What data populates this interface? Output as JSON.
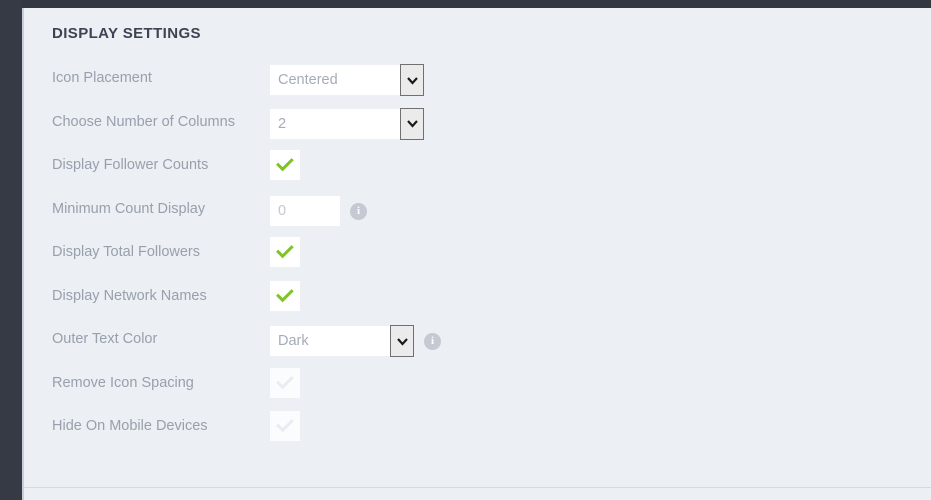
{
  "panel": {
    "title": "DISPLAY SETTINGS"
  },
  "colors": {
    "page_background": "#eceff3",
    "chrome_dark": "#353a45",
    "topbar_dark": "#333741",
    "label_text": "#98a0ad",
    "title_text": "#3d4352",
    "check_green": "#7dc424",
    "check_disabled": "#e9edf1",
    "info_icon": "#c4c9d2"
  },
  "settings": [
    {
      "label": "Icon Placement",
      "control": "select",
      "value": "Centered",
      "width": "wide",
      "info": false
    },
    {
      "label": "Choose Number of Columns",
      "control": "select",
      "value": "2",
      "width": "mid",
      "info": false
    },
    {
      "label": "Display Follower Counts",
      "control": "checkbox",
      "checked": true,
      "disabled": false,
      "info": false
    },
    {
      "label": "Minimum Count Display",
      "control": "text",
      "value": "",
      "placeholder": "0",
      "info": true
    },
    {
      "label": "Display Total Followers",
      "control": "checkbox",
      "checked": true,
      "disabled": false,
      "info": false
    },
    {
      "label": "Display Network Names",
      "control": "checkbox",
      "checked": true,
      "disabled": false,
      "info": false
    },
    {
      "label": "Outer Text Color",
      "control": "select",
      "value": "Dark",
      "width": "narrow",
      "info": true
    },
    {
      "label": "Remove Icon Spacing",
      "control": "checkbox",
      "checked": true,
      "disabled": true,
      "info": false
    },
    {
      "label": "Hide On Mobile Devices",
      "control": "checkbox",
      "checked": true,
      "disabled": true,
      "info": false
    }
  ],
  "icons": {
    "info": "i",
    "chevron_down": "chevron-down-icon",
    "check": "check-icon"
  }
}
